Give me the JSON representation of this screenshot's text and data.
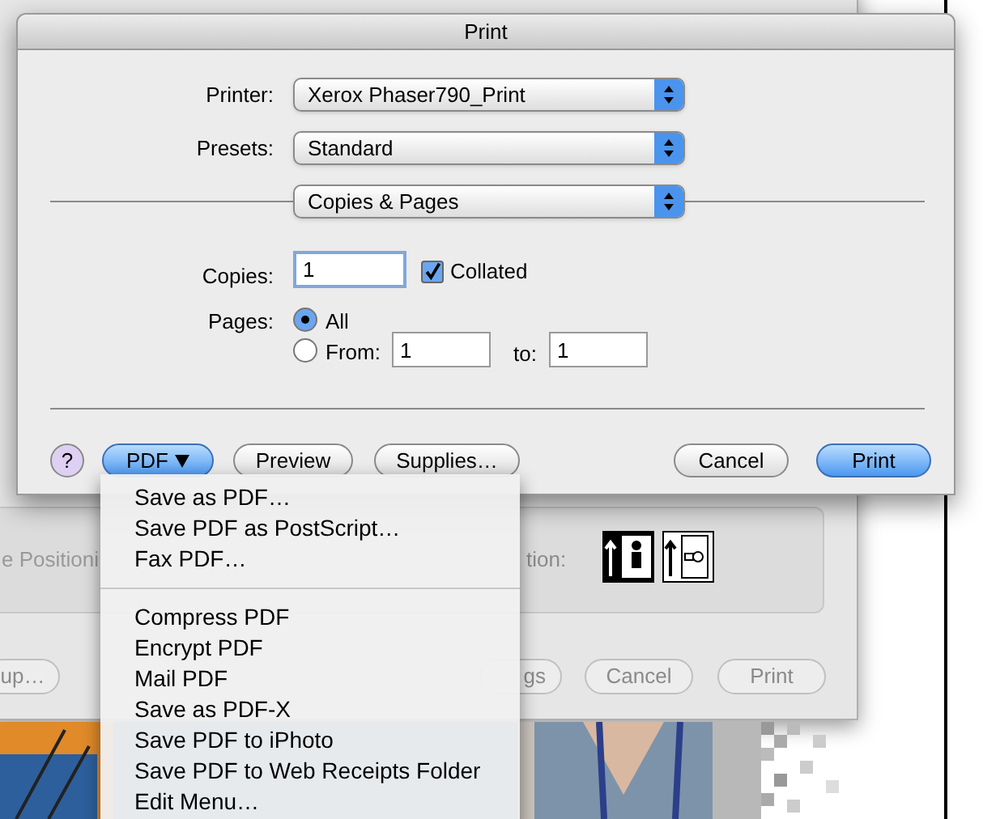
{
  "back_window": {
    "texts": [
      {
        "kind": "left",
        "text": "e Positioni"
      },
      {
        "kind": "right",
        "text": "tion:"
      }
    ],
    "buttons": [
      {
        "label": "up…"
      },
      {
        "label": "gs"
      },
      {
        "label": "Cancel"
      },
      {
        "label": "Print"
      }
    ]
  },
  "print_sheet": {
    "title": "Print",
    "printer": {
      "label": "Printer:",
      "value": "Xerox Phaser790_Print"
    },
    "presets": {
      "label": "Presets:",
      "value": "Standard"
    },
    "panel": {
      "value": "Copies & Pages"
    },
    "copies": {
      "label": "Copies:",
      "value": "1"
    },
    "collated": {
      "label": "Collated",
      "checked": true
    },
    "pages": {
      "label": "Pages:",
      "all": {
        "label": "All",
        "selected": true
      },
      "from": {
        "label": "From:",
        "selected": false,
        "value": "1"
      },
      "to": {
        "label": "to:",
        "value": "1"
      }
    },
    "buttons": [
      {
        "kind": "help",
        "label": "?",
        "default": false
      },
      {
        "kind": "menu",
        "label": "PDF",
        "default": true
      },
      {
        "kind": "push",
        "label": "Preview",
        "default": false
      },
      {
        "kind": "push",
        "label": "Supplies…",
        "default": false
      },
      {
        "kind": "push",
        "label": "Cancel",
        "default": false
      },
      {
        "kind": "push",
        "label": "Print",
        "default": true
      }
    ]
  },
  "pdf_menu": {
    "groups": [
      [
        "Save as PDF…",
        "Save PDF as PostScript…",
        "Fax PDF…"
      ],
      [
        "Compress PDF",
        "Encrypt PDF",
        "Mail PDF",
        "Save as PDF-X",
        "Save PDF to iPhoto",
        "Save PDF to Web Receipts Folder",
        "Edit Menu…"
      ]
    ]
  }
}
